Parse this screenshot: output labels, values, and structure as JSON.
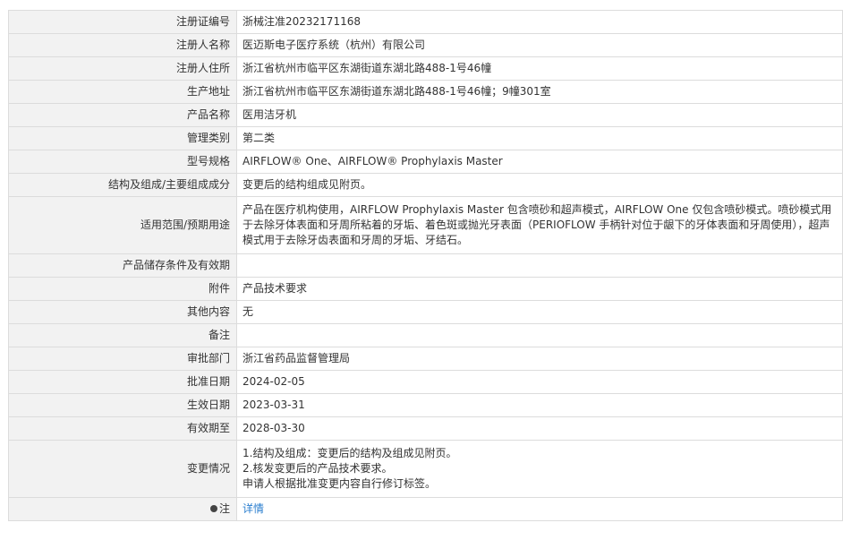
{
  "rows": [
    {
      "label": "注册证编号",
      "value": "浙械注准20232171168"
    },
    {
      "label": "注册人名称",
      "value": "医迈斯电子医疗系统（杭州）有限公司"
    },
    {
      "label": "注册人住所",
      "value": "浙江省杭州市临平区东湖街道东湖北路488-1号46幢"
    },
    {
      "label": "生产地址",
      "value": "浙江省杭州市临平区东湖街道东湖北路488-1号46幢；9幢301室"
    },
    {
      "label": "产品名称",
      "value": "医用洁牙机"
    },
    {
      "label": "管理类别",
      "value": "第二类"
    },
    {
      "label": "型号规格",
      "value": "AIRFLOW® One、AIRFLOW® Prophylaxis Master"
    },
    {
      "label": "结构及组成/主要组成成分",
      "value": "变更后的结构组成见附页。"
    },
    {
      "label": "适用范围/预期用途",
      "lines": [
        "产品在医疗机构使用，AIRFLOW Prophylaxis Master 包含喷砂和超声模式，AIRFLOW One 仅包含喷砂模式。喷砂模式用",
        "于去除牙体表面和牙周所粘着的牙垢、着色斑或抛光牙表面（PERIOFLOW 手柄针对位于龈下的牙体表面和牙周使用），超声",
        "模式用于去除牙齿表面和牙周的牙垢、牙结石。"
      ]
    },
    {
      "label": "产品储存条件及有效期",
      "value": ""
    },
    {
      "label": "附件",
      "value": "产品技术要求"
    },
    {
      "label": "其他内容",
      "value": "无"
    },
    {
      "label": "备注",
      "value": ""
    },
    {
      "label": "审批部门",
      "value": "浙江省药品监督管理局"
    },
    {
      "label": "批准日期",
      "value": "2024-02-05"
    },
    {
      "label": "生效日期",
      "value": "2023-03-31"
    },
    {
      "label": "有效期至",
      "value": "2028-03-30"
    },
    {
      "label": "变更情况",
      "lines": [
        "1.结构及组成：变更后的结构及组成见附页。",
        "2.核发变更后的产品技术要求。",
        "申请人根据批准变更内容自行修订标签。"
      ]
    },
    {
      "label": "注",
      "value": "详情"
    }
  ]
}
